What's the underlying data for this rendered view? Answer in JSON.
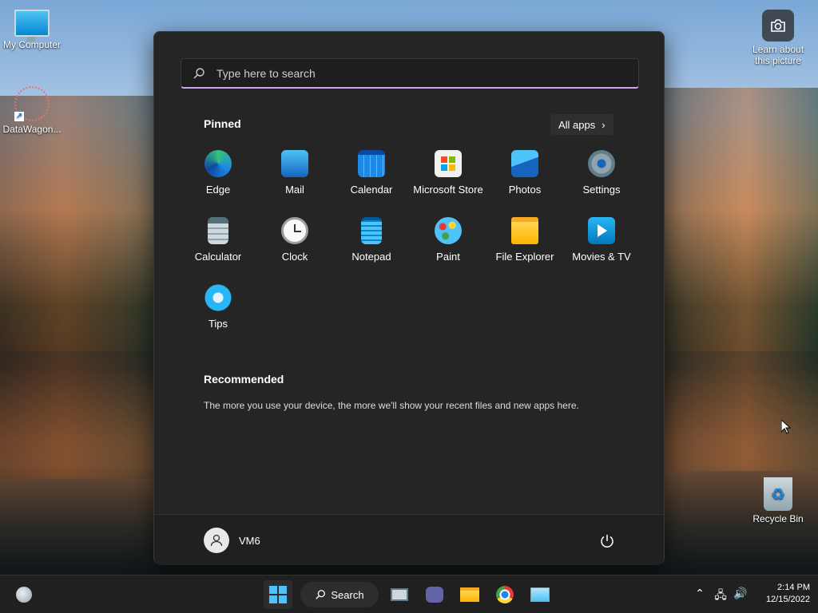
{
  "desktop": {
    "icons": [
      {
        "label": "My Computer"
      },
      {
        "label": "DataWagon..."
      },
      {
        "label": "Learn about this picture"
      },
      {
        "label": "Recycle Bin"
      }
    ]
  },
  "start_menu": {
    "search_placeholder": "Type here to search",
    "pinned_title": "Pinned",
    "all_apps_label": "All apps",
    "pinned": [
      {
        "label": "Edge",
        "icon": "edge-icon"
      },
      {
        "label": "Mail",
        "icon": "mail-icon"
      },
      {
        "label": "Calendar",
        "icon": "calendar-icon"
      },
      {
        "label": "Microsoft Store",
        "icon": "store-icon"
      },
      {
        "label": "Photos",
        "icon": "photos-icon"
      },
      {
        "label": "Settings",
        "icon": "gear-icon"
      },
      {
        "label": "Calculator",
        "icon": "calculator-icon"
      },
      {
        "label": "Clock",
        "icon": "clock-icon"
      },
      {
        "label": "Notepad",
        "icon": "notepad-icon"
      },
      {
        "label": "Paint",
        "icon": "paint-icon"
      },
      {
        "label": "File Explorer",
        "icon": "folder-icon"
      },
      {
        "label": "Movies & TV",
        "icon": "movies-icon"
      },
      {
        "label": "Tips",
        "icon": "lightbulb-icon"
      }
    ],
    "recommended_title": "Recommended",
    "recommended_text": "The more you use your device, the more we'll show your recent files and new apps here.",
    "user_name": "VM6"
  },
  "taskbar": {
    "search_label": "Search",
    "time": "2:14 PM",
    "date": "12/15/2022"
  }
}
